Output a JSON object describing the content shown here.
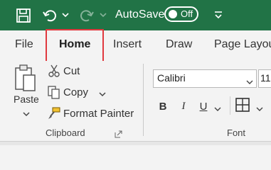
{
  "titlebar": {
    "bg_color": "#217346",
    "autosave_label": "AutoSave",
    "autosave_state": "Off",
    "icons": [
      "save-icon",
      "undo-icon",
      "chevron-down-icon",
      "redo-icon",
      "customize-toolbar-icon"
    ]
  },
  "tabs": [
    {
      "label": "File"
    },
    {
      "label": "Home"
    },
    {
      "label": "Insert"
    },
    {
      "label": "Draw"
    },
    {
      "label": "Page Layout"
    }
  ],
  "active_tab": "Home",
  "highlight_color": "#e0393e",
  "clipboard": {
    "paste_label": "Paste",
    "cut_label": "Cut",
    "copy_label": "Copy",
    "format_painter_label": "Format Painter",
    "group_label": "Clipboard"
  },
  "font": {
    "font_name": "Calibri",
    "font_size": "11",
    "bold_label": "B",
    "italic_label": "I",
    "underline_label": "U",
    "group_label": "Font"
  }
}
